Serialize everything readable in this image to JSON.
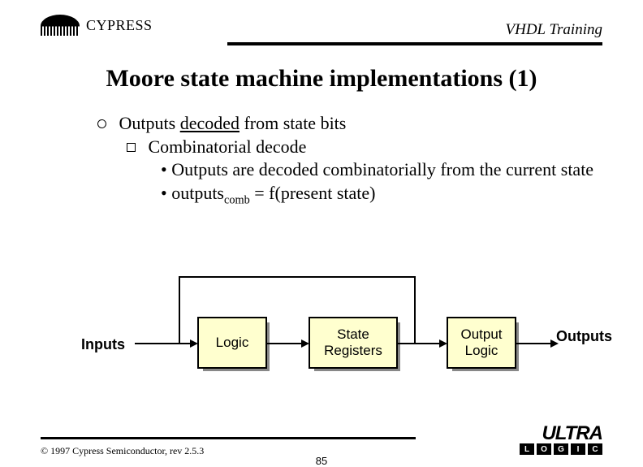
{
  "header": {
    "brand": "CYPRESS",
    "subject": "VHDL Training"
  },
  "title": "Moore state machine implementations (1)",
  "bullets": {
    "l1": "Outputs",
    "l1_u": "decoded",
    "l1_rest": " from state bits",
    "l2": "Combinatorial decode",
    "l3a": "Outputs are decoded combinatorially from the current state",
    "l3b_pre": "outputs",
    "l3b_sub": "comb",
    "l3b_post": " = f(present state)"
  },
  "diagram": {
    "inputs": "Inputs",
    "box1": "Logic",
    "box2": "State Registers",
    "box3": "Output Logic",
    "outputs": "Outputs"
  },
  "footer": {
    "copyright": "© 1997 Cypress Semiconductor, rev 2.5.3",
    "page": "85",
    "ultra": "ULTRA",
    "logic": [
      "L",
      "O",
      "G",
      "I",
      "C"
    ]
  }
}
